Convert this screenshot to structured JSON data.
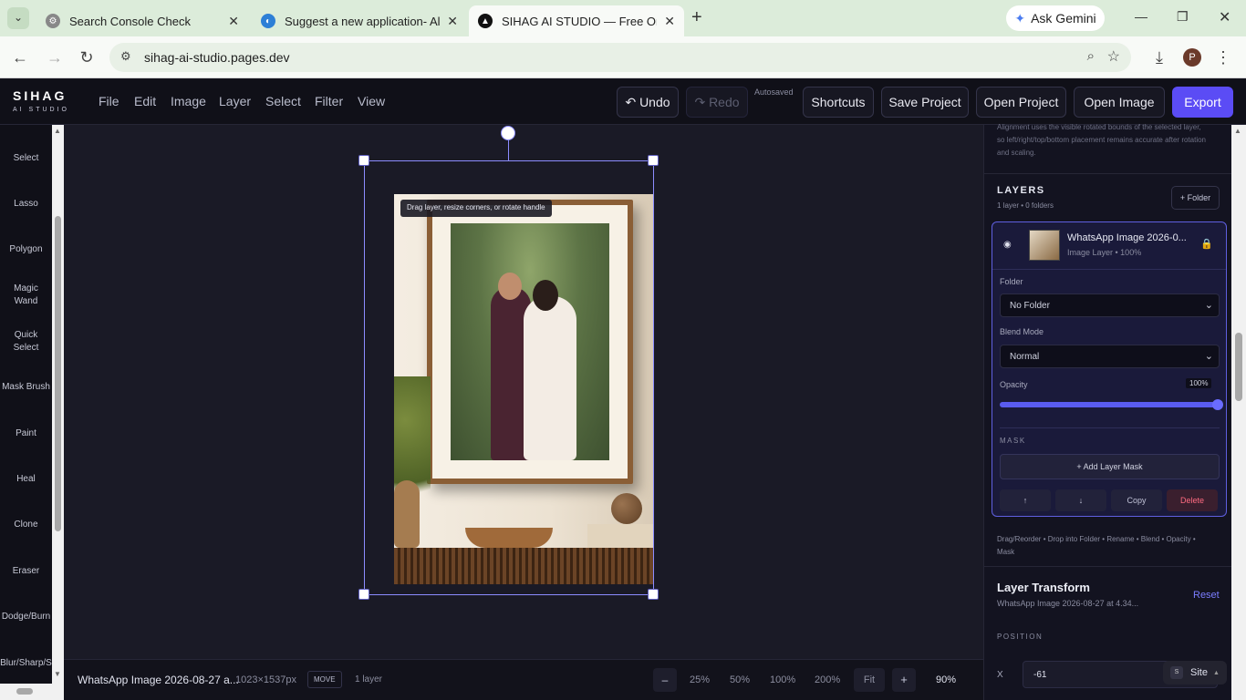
{
  "browser": {
    "tabs": [
      {
        "title": "Search Console Check"
      },
      {
        "title": "Suggest a new application- Alte"
      },
      {
        "title": "SIHAG AI STUDIO — Free Online"
      }
    ],
    "gemini_label": "Ask Gemini",
    "url": "sihag-ai-studio.pages.dev",
    "profile_initial": "P"
  },
  "app": {
    "logo": "SIHAG",
    "logo_sub": "AI STUDIO",
    "menus": [
      "File",
      "Edit",
      "Image",
      "Layer",
      "Select",
      "Filter",
      "View"
    ],
    "undo": "↶ Undo",
    "redo": "↷ Redo",
    "autosaved": "Autosaved",
    "shortcuts": "Shortcuts",
    "save_project": "Save Project",
    "open_project": "Open Project",
    "open_image": "Open Image",
    "export": "Export"
  },
  "tools": [
    "Select",
    "Lasso",
    "Polygon",
    "Magic Wand",
    "Quick Select",
    "Mask Brush",
    "Paint",
    "Heal",
    "Clone",
    "Eraser",
    "Dodge/Burn",
    "Blur/Sharp/S"
  ],
  "canvas": {
    "hint": "Drag layer, resize corners, or rotate handle"
  },
  "status": {
    "filename": "WhatsApp Image 2026-08-27 a...",
    "dimensions": "1023×1537px",
    "mode": "MOVE",
    "layers": "1 layer",
    "zoom_minus": "–",
    "zoom_presets": [
      "25%",
      "50%",
      "100%",
      "200%"
    ],
    "fit": "Fit",
    "zoom_plus": "+",
    "zoom": "90%"
  },
  "panel": {
    "align_note": "Alignment uses the visible rotated bounds of the selected layer, so left/right/top/bottom placement remains accurate after rotation and scaling.",
    "layers_title": "LAYERS",
    "layers_count": "1 layer • 0 folders",
    "add_folder": "+ Folder",
    "layer_name": "WhatsApp Image 2026-0...",
    "layer_meta": "Image Layer • 100%",
    "folder_label": "Folder",
    "folder_value": "No Folder",
    "blend_label": "Blend Mode",
    "blend_value": "Normal",
    "opacity_label": "Opacity",
    "opacity_value": "100%",
    "mask_title": "MASK",
    "add_mask": "+ Add Layer Mask",
    "btn_up": "↑",
    "btn_down": "↓",
    "btn_copy": "Copy",
    "btn_delete": "Delete",
    "help": "Drag/Reorder • Drop into Folder • Rename • Blend • Opacity • Mask",
    "transform_title": "Layer Transform",
    "reset": "Reset",
    "transform_sub": "WhatsApp Image 2026-08-27 at 4.34...",
    "position_label": "POSITION",
    "x_label": "X",
    "x_value": "-61",
    "site_label": "Site",
    "site_badge": "S"
  },
  "colors": {
    "accent": "#6a5cff",
    "export": "#5b4cf5",
    "delete": "#ff6b81"
  }
}
